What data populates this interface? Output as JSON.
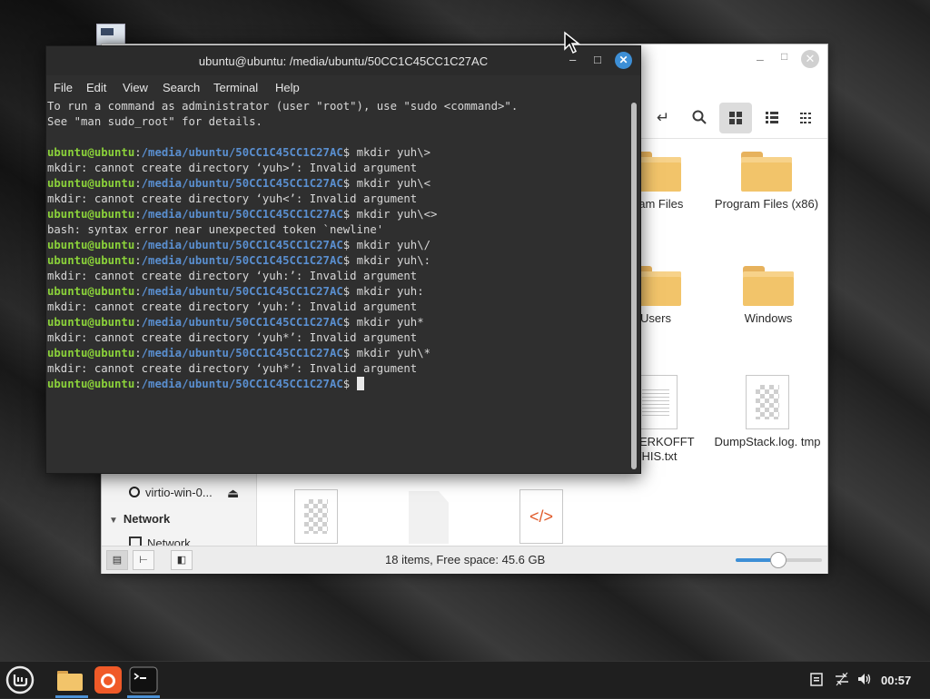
{
  "terminal": {
    "title": "ubuntu@ubuntu: /media/ubuntu/50CC1C45CC1C27AC",
    "menu": [
      "File",
      "Edit",
      "View",
      "Search",
      "Terminal",
      "Help"
    ],
    "prompt_user": "ubuntu@ubuntu",
    "prompt_path": "/media/ubuntu/50CC1C45CC1C27AC",
    "lines": [
      {
        "type": "out",
        "text": "To run a command as administrator (user \"root\"), use \"sudo <command>\"."
      },
      {
        "type": "out",
        "text": "See \"man sudo_root\" for details."
      },
      {
        "type": "out",
        "text": ""
      },
      {
        "type": "cmd",
        "text": "mkdir yuh\\>"
      },
      {
        "type": "out",
        "text": "mkdir: cannot create directory ‘yuh>’: Invalid argument"
      },
      {
        "type": "cmd",
        "text": "mkdir yuh\\<"
      },
      {
        "type": "out",
        "text": "mkdir: cannot create directory ‘yuh<’: Invalid argument"
      },
      {
        "type": "cmd",
        "text": "mkdir yuh\\<>"
      },
      {
        "type": "out",
        "text": "bash: syntax error near unexpected token `newline'"
      },
      {
        "type": "cmd",
        "text": "mkdir yuh\\/"
      },
      {
        "type": "cmd",
        "text": "mkdir yuh\\:"
      },
      {
        "type": "out",
        "text": "mkdir: cannot create directory ‘yuh:’: Invalid argument"
      },
      {
        "type": "cmd",
        "text": "mkdir yuh:"
      },
      {
        "type": "out",
        "text": "mkdir: cannot create directory ‘yuh:’: Invalid argument"
      },
      {
        "type": "cmd",
        "text": "mkdir yuh*"
      },
      {
        "type": "out",
        "text": "mkdir: cannot create directory ‘yuh*’: Invalid argument"
      },
      {
        "type": "cmd",
        "text": "mkdir yuh\\*"
      },
      {
        "type": "out",
        "text": "mkdir: cannot create directory ‘yuh*’: Invalid argument"
      },
      {
        "type": "prompt",
        "text": ""
      }
    ]
  },
  "file_manager": {
    "sidebar": {
      "drive_label": "virtio-win-0...",
      "network_header": "Network",
      "network_item": "Network"
    },
    "items": [
      {
        "label": "gram Files",
        "kind": "folder"
      },
      {
        "label": "Program Files (x86)",
        "kind": "folder"
      },
      {
        "label": "Users",
        "kind": "folder"
      },
      {
        "label": "Windows",
        "kind": "folder"
      },
      {
        "label": "OTJERKOFFT THIS.txt",
        "kind": "text"
      },
      {
        "label": "DumpStack.log. tmp",
        "kind": "image"
      }
    ],
    "status": "18 items, Free space: 45.6 GB",
    "zoom_level": 0.48
  },
  "taskbar": {
    "clock": "00:57"
  },
  "colors": {
    "accent": "#3d8fd6",
    "prompt_user": "#8bd23a",
    "prompt_path": "#5a8fd0",
    "folder": "#f2c46a"
  }
}
